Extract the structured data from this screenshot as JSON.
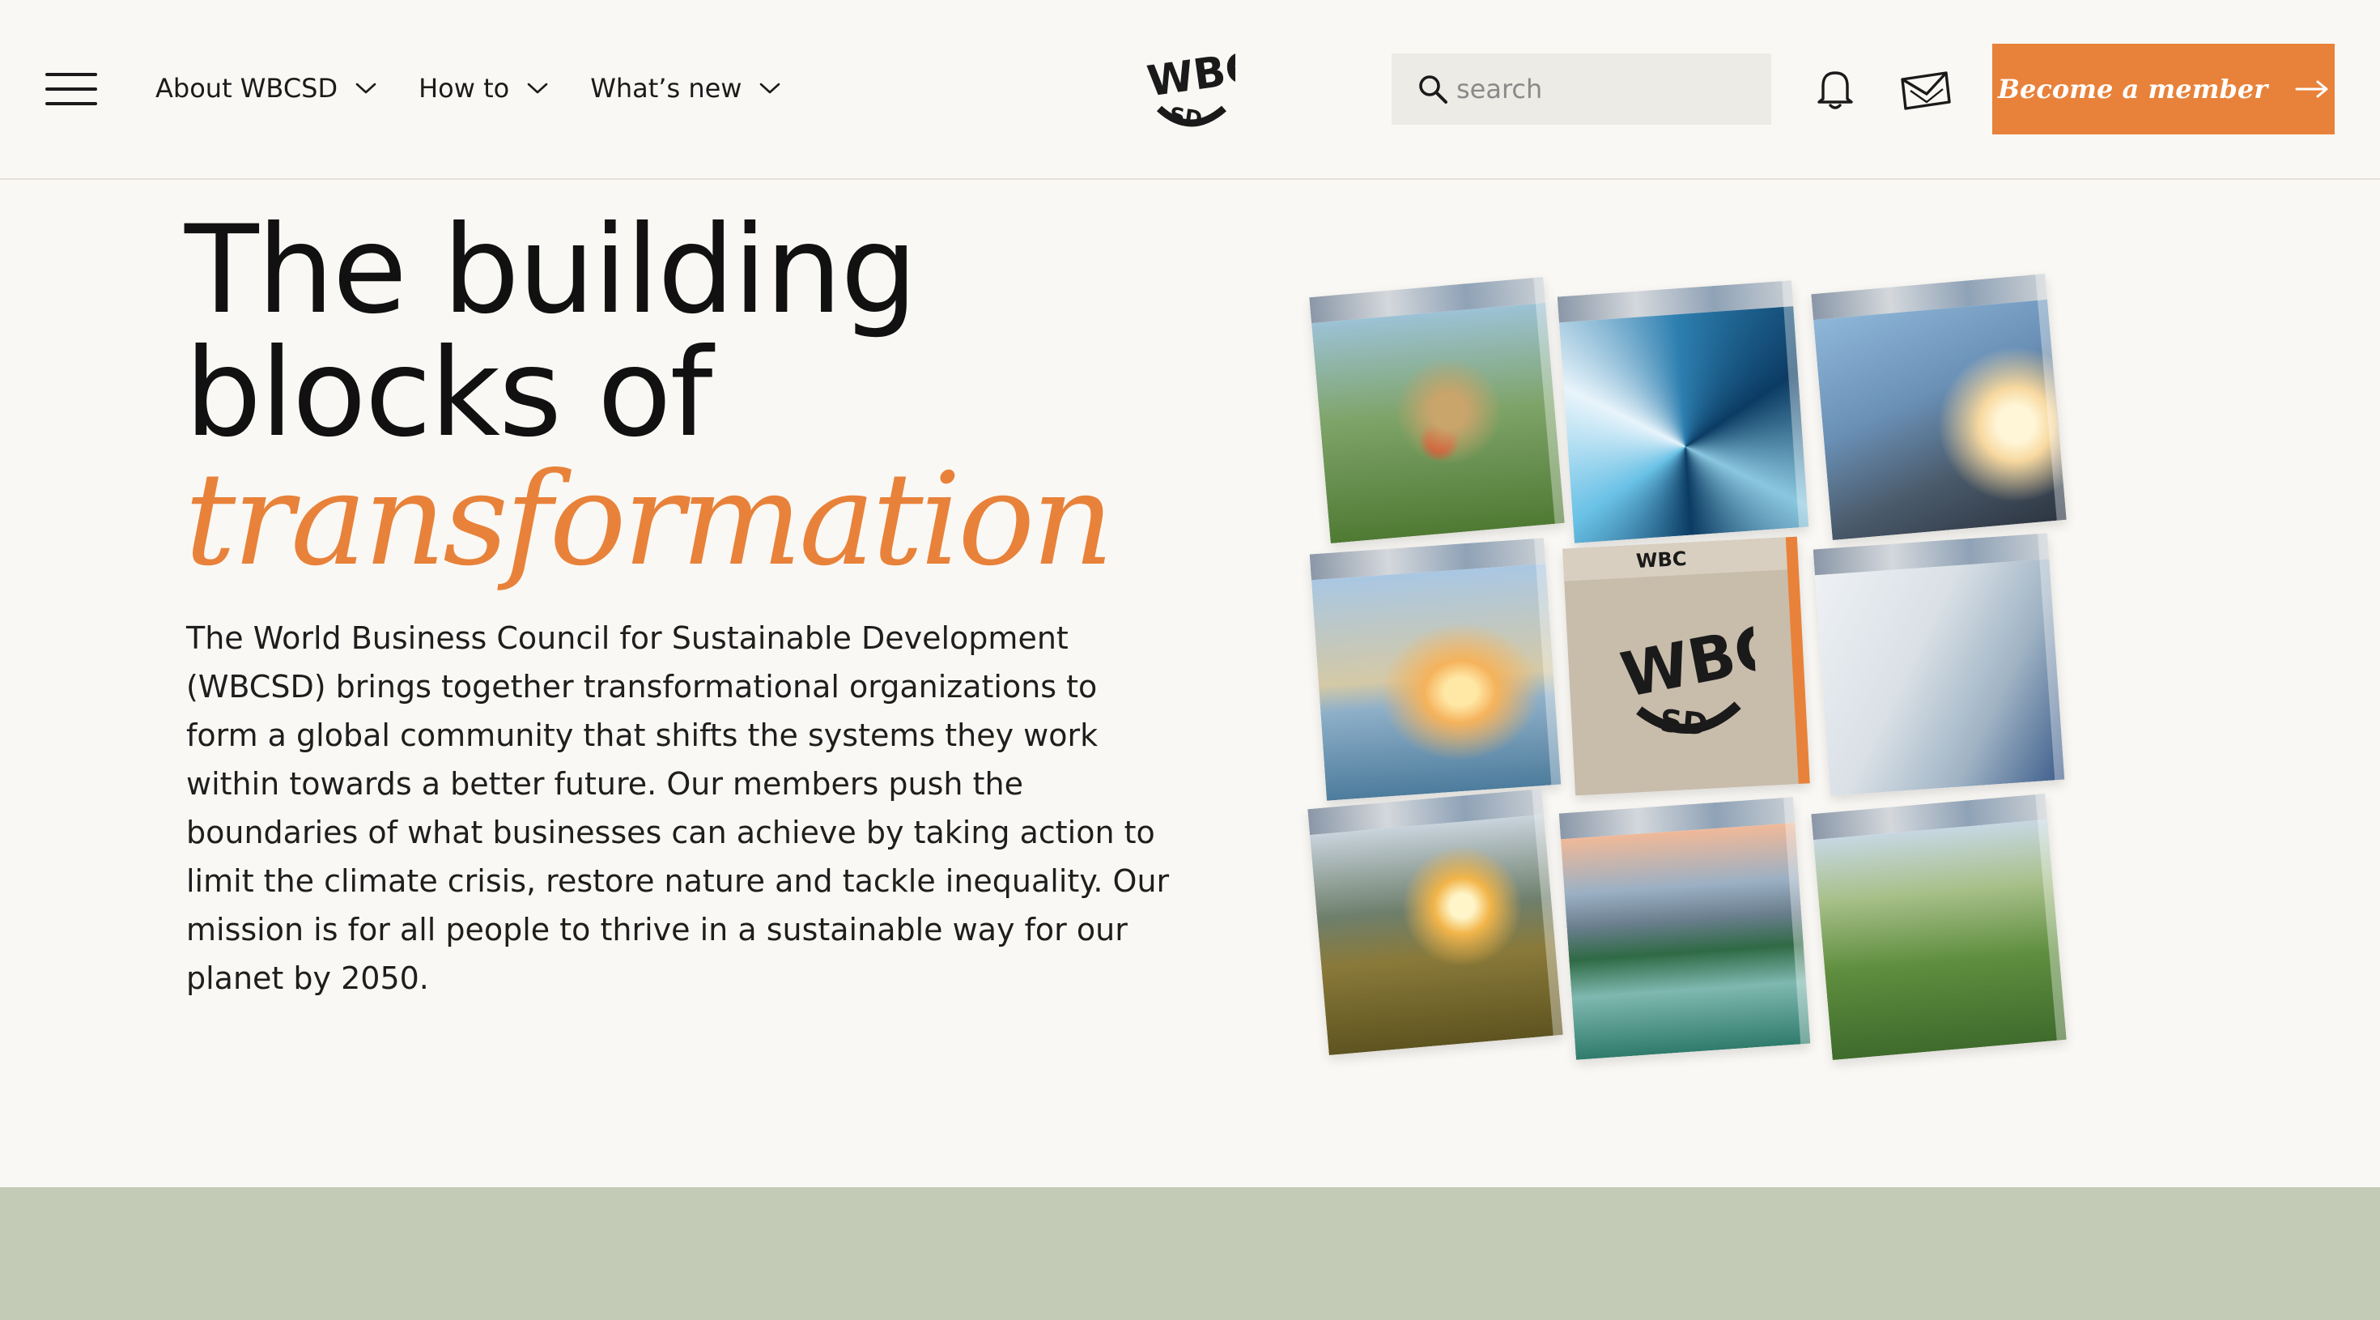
{
  "nav": {
    "items": [
      {
        "label": "About WBCSD"
      },
      {
        "label": "How to"
      },
      {
        "label": "What’s new"
      }
    ]
  },
  "logo": {
    "text": "WBCSD"
  },
  "search": {
    "placeholder": "search",
    "value": ""
  },
  "cta": {
    "label": "Become a member"
  },
  "hero": {
    "title_line1": "The building",
    "title_line2": "blocks of",
    "title_accent": "transformation",
    "body": "The World Business Council for Sustainable Development (WBCSD) brings together transformational organizations to form a global community that shifts the systems they work within towards a better future. Our members push the boundaries of what businesses can achieve by taking action to limit the climate crisis, restore nature and tackle inequality. Our mission is for all people to thrive in a sustainable way for our planet by 2050."
  },
  "colors": {
    "background": "#faf8f4",
    "accent": "#e8823a",
    "search_bg": "#ecebe5",
    "band": "#c3cbb7"
  },
  "icons": [
    "menu-icon",
    "chevron-down-icon",
    "search-icon",
    "bell-icon",
    "mail-icon",
    "arrow-right-icon"
  ]
}
